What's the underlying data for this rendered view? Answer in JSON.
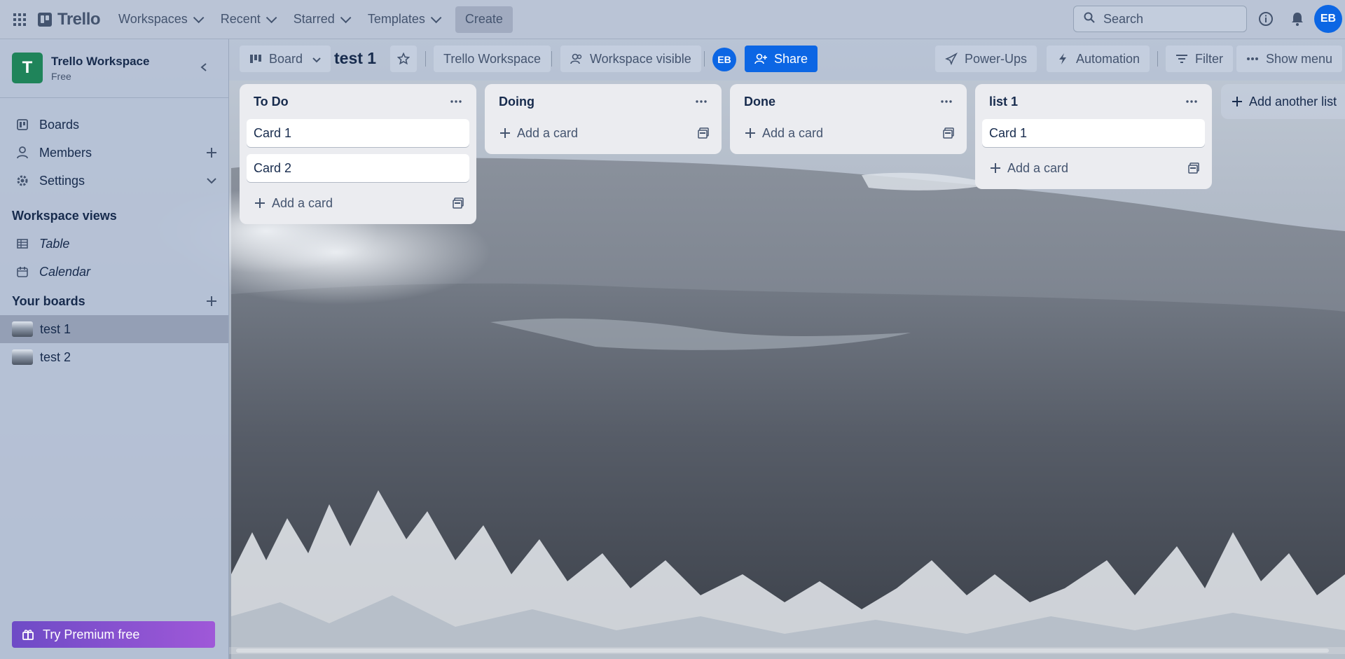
{
  "topnav": {
    "logo": "Trello",
    "menus": [
      "Workspaces",
      "Recent",
      "Starred",
      "Templates"
    ],
    "create_label": "Create",
    "search_placeholder": "Search",
    "user_initials": "EB"
  },
  "sidebar": {
    "workspace_initial": "T",
    "workspace_name": "Trello Workspace",
    "workspace_plan": "Free",
    "items": [
      {
        "label": "Boards",
        "icon": "board-icon"
      },
      {
        "label": "Members",
        "icon": "member-icon"
      },
      {
        "label": "Settings",
        "icon": "gear-icon"
      }
    ],
    "views_heading": "Workspace views",
    "views": [
      {
        "label": "Table",
        "icon": "table-icon"
      },
      {
        "label": "Calendar",
        "icon": "calendar-icon"
      }
    ],
    "boards_heading": "Your boards",
    "boards": [
      "test 1",
      "test 2"
    ],
    "premium_label": "Try Premium free"
  },
  "board": {
    "view_label": "Board",
    "title": "test 1",
    "workspace_label": "Trello Workspace",
    "visibility_label": "Workspace visible",
    "member_initials": "EB",
    "share_label": "Share",
    "powerups_label": "Power-Ups",
    "automation_label": "Automation",
    "filter_label": "Filter",
    "menu_label": "Show menu",
    "add_list_label": "Add another list",
    "add_card_label": "Add a card",
    "lists": [
      {
        "title": "To Do",
        "cards": [
          "Card 1",
          "Card 2"
        ]
      },
      {
        "title": "Doing",
        "cards": []
      },
      {
        "title": "Done",
        "cards": []
      },
      {
        "title": "list 1",
        "cards": [
          "Card 1"
        ]
      }
    ]
  },
  "colors": {
    "brand_blue": "#0c66e4",
    "workspace_green": "#1f845a",
    "premium_purple": "#8f56d6"
  }
}
